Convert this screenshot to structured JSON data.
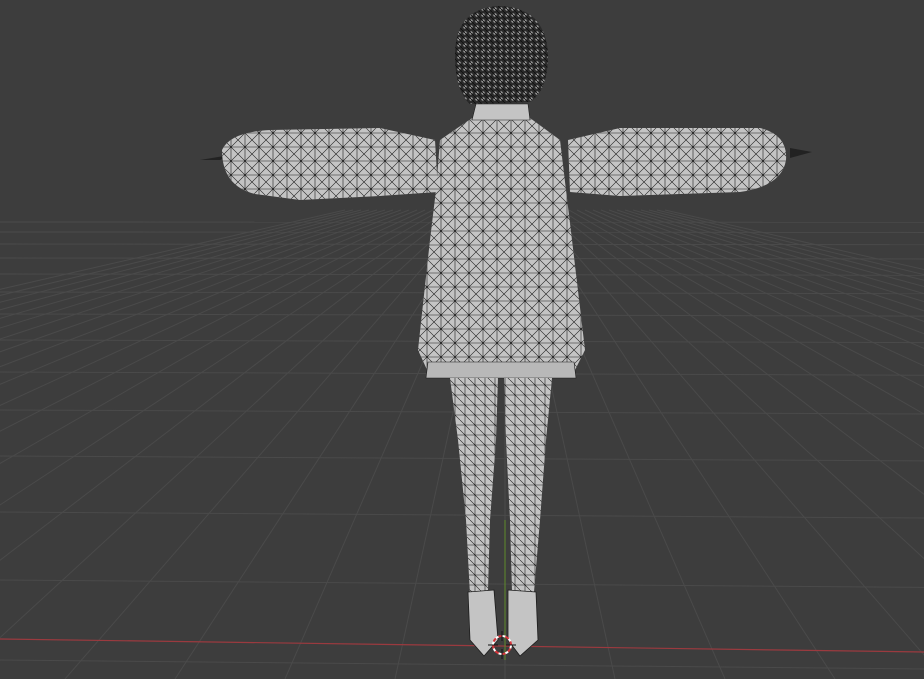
{
  "viewport": {
    "mode": "wireframe-overlay",
    "view": "back-orthographic-perspective",
    "colors": {
      "background": "#3d3d3d",
      "grid_line": "#4a4a4a",
      "x_axis": "#9b3a3f",
      "y_axis": "#5f8a2b",
      "mesh_fill": "#c4c4c4",
      "mesh_wire": "#1c1c1c",
      "hair": "#2a2a2a"
    },
    "objects": [
      {
        "name": "character-mesh",
        "icon": "mesh-icon"
      },
      {
        "name": "3d-cursor",
        "icon": "cursor-3d-icon"
      }
    ]
  }
}
